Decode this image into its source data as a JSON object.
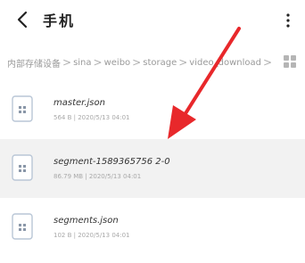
{
  "header": {
    "title": "手机",
    "back_icon": "chevron-left-icon",
    "more_icon": "more-vertical-icon"
  },
  "breadcrumb": {
    "items": [
      "内部存储设备",
      "sina",
      "weibo",
      "storage",
      "video_download"
    ],
    "separator": ">",
    "view_icon": "grid-view-icon"
  },
  "files": [
    {
      "name": "master.json",
      "meta": "564 B | 2020/5/13 04:01",
      "selected": false,
      "icon": "file-icon"
    },
    {
      "name": "segment-1589365756 2-0",
      "meta": "86.79 MB | 2020/5/13 04:01",
      "selected": true,
      "icon": "file-icon"
    },
    {
      "name": "segments.json",
      "meta": "102 B | 2020/5/13 04:01",
      "selected": false,
      "icon": "file-icon"
    }
  ],
  "colors": {
    "arrow": "#e8282b",
    "selected_row": "#f2f2f2",
    "icon_border": "#b9c6d6",
    "icon_fill": "#8a97a8"
  }
}
